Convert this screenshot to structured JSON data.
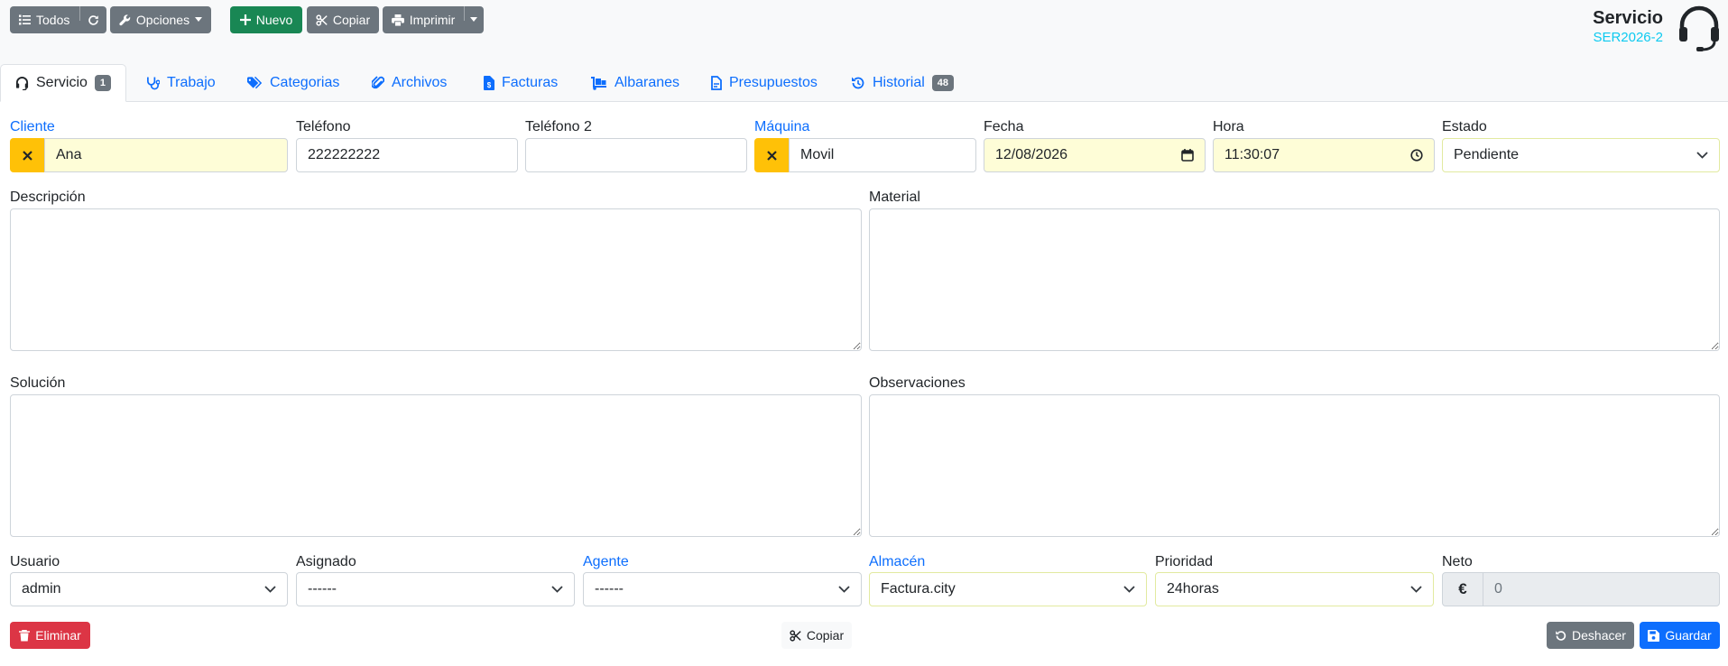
{
  "toolbar": {
    "all_label": "Todos",
    "options_label": "Opciones",
    "new_label": "Nuevo",
    "copy_label": "Copiar",
    "print_label": "Imprimir"
  },
  "header": {
    "title": "Servicio",
    "code": "SER2026-2"
  },
  "tabs": [
    {
      "label": "Servicio",
      "badge": "1",
      "icon": "headset-icon",
      "active": true
    },
    {
      "label": "Trabajo",
      "icon": "stethoscope-icon"
    },
    {
      "label": "Categorias",
      "icon": "tags-icon"
    },
    {
      "label": "Archivos",
      "icon": "paperclip-icon"
    },
    {
      "label": "Facturas",
      "icon": "invoice-dollar-icon"
    },
    {
      "label": "Albaranes",
      "icon": "dolly-icon"
    },
    {
      "label": "Presupuestos",
      "icon": "file-icon"
    },
    {
      "label": "Historial",
      "badge": "48",
      "icon": "history-icon"
    }
  ],
  "form": {
    "cliente": {
      "label": "Cliente",
      "value": "Ana"
    },
    "telefono": {
      "label": "Teléfono",
      "value": "222222222"
    },
    "telefono2": {
      "label": "Teléfono 2",
      "value": ""
    },
    "maquina": {
      "label": "Máquina",
      "value": "Movil"
    },
    "fecha": {
      "label": "Fecha",
      "value": "12/08/2026"
    },
    "hora": {
      "label": "Hora",
      "value": "11:30:07"
    },
    "estado": {
      "label": "Estado",
      "value": "Pendiente"
    },
    "descripcion": {
      "label": "Descripción",
      "value": ""
    },
    "material": {
      "label": "Material",
      "value": ""
    },
    "solucion": {
      "label": "Solución",
      "value": ""
    },
    "observaciones": {
      "label": "Observaciones",
      "value": ""
    },
    "usuario": {
      "label": "Usuario",
      "value": "admin"
    },
    "asignado": {
      "label": "Asignado",
      "value": "------"
    },
    "agente": {
      "label": "Agente",
      "value": "------"
    },
    "almacen": {
      "label": "Almacén",
      "value": "Factura.city"
    },
    "prioridad": {
      "label": "Prioridad",
      "value": "24horas"
    },
    "neto": {
      "label": "Neto",
      "currency": "€",
      "value": "0"
    }
  },
  "footer": {
    "delete_label": "Eliminar",
    "copy_label": "Copiar",
    "undo_label": "Deshacer",
    "save_label": "Guardar"
  },
  "colors": {
    "primary": "#0d6efd",
    "secondary": "#6c757d",
    "success": "#198754",
    "danger": "#dc3545",
    "warning": "#ffc107",
    "info": "#0dcaf0",
    "required_bg": "#fefdd7"
  }
}
